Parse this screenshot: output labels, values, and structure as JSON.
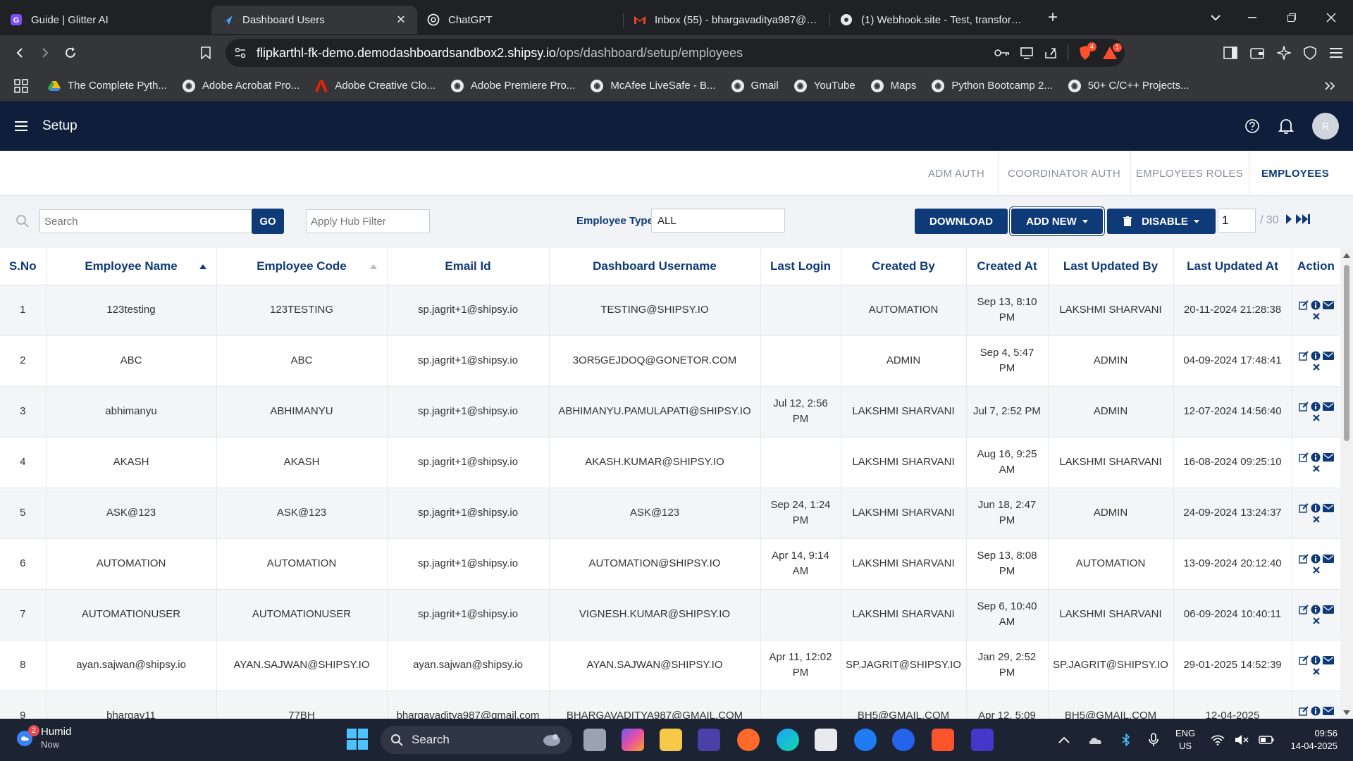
{
  "browser": {
    "tabs": [
      {
        "title": "Guide | Glitter AI",
        "active": false
      },
      {
        "title": "Dashboard Users",
        "active": true
      },
      {
        "title": "ChatGPT",
        "active": false
      },
      {
        "title": "Inbox (55) - bhargavaditya987@gm",
        "active": false
      },
      {
        "title": "(1) Webhook.site - Test, transform a",
        "active": false
      }
    ],
    "url_host": "flipkarthl-fk-demo.demodashboardsandbox2.shipsy.io",
    "url_path": "/ops/dashboard/setup/employees",
    "extension_badges": [
      "4",
      "1"
    ],
    "bookmarks": [
      "The Complete Pyth...",
      "Adobe Acrobat Pro...",
      "Adobe Creative Clo...",
      "Adobe Premiere Pro...",
      "McAfee LiveSafe - B...",
      "Gmail",
      "YouTube",
      "Maps",
      "Python Bootcamp 2...",
      "50+ C/C++ Projects..."
    ]
  },
  "app": {
    "title": "Setup",
    "avatar_initial": "R",
    "sub_tabs": [
      "ADM AUTH",
      "COORDINATOR AUTH",
      "EMPLOYEES ROLES",
      "EMPLOYEES"
    ],
    "active_sub_tab": "EMPLOYEES",
    "colors": {
      "header_bg": "#0e1e3b",
      "primary": "#0e3a78"
    }
  },
  "toolbar": {
    "search_placeholder": "Search",
    "go_label": "GO",
    "hub_filter_placeholder": "Apply Hub Filter",
    "employee_type_label": "Employee Type",
    "employee_type_value": "ALL",
    "download_label": "DOWNLOAD",
    "add_new_label": "ADD NEW",
    "disable_label": "DISABLE",
    "page_value": "1",
    "page_total": "/ 30"
  },
  "table": {
    "columns": [
      "S.No",
      "Employee Name",
      "Employee Code",
      "Email Id",
      "Dashboard Username",
      "Last Login",
      "Created By",
      "Created At",
      "Last Updated By",
      "Last Updated At",
      "Action"
    ],
    "rows": [
      {
        "sno": "1",
        "name": "123testing",
        "code": "123TESTING",
        "email": "sp.jagrit+1@shipsy.io",
        "username": "TESTING@SHIPSY.IO",
        "last_login": "",
        "created_by": "AUTOMATION",
        "created_at": "Sep 13, 8:10 PM",
        "updated_by": "LAKSHMI SHARVANI",
        "updated_at": "20-11-2024 21:28:38"
      },
      {
        "sno": "2",
        "name": "ABC",
        "code": "ABC",
        "email": "sp.jagrit+1@shipsy.io",
        "username": "3OR5GEJDOQ@GONETOR.COM",
        "last_login": "",
        "created_by": "ADMIN",
        "created_at": "Sep 4, 5:47 PM",
        "updated_by": "ADMIN",
        "updated_at": "04-09-2024 17:48:41"
      },
      {
        "sno": "3",
        "name": "abhimanyu",
        "code": "ABHIMANYU",
        "email": "sp.jagrit+1@shipsy.io",
        "username": "ABHIMANYU.PAMULAPATI@SHIPSY.IO",
        "last_login": "Jul 12, 2:56 PM",
        "created_by": "LAKSHMI SHARVANI",
        "created_at": "Jul 7, 2:52 PM",
        "updated_by": "ADMIN",
        "updated_at": "12-07-2024 14:56:40"
      },
      {
        "sno": "4",
        "name": "AKASH",
        "code": "AKASH",
        "email": "sp.jagrit+1@shipsy.io",
        "username": "AKASH.KUMAR@SHIPSY.IO",
        "last_login": "",
        "created_by": "LAKSHMI SHARVANI",
        "created_at": "Aug 16, 9:25 AM",
        "updated_by": "LAKSHMI SHARVANI",
        "updated_at": "16-08-2024 09:25:10"
      },
      {
        "sno": "5",
        "name": "ASK@123",
        "code": "ASK@123",
        "email": "sp.jagrit+1@shipsy.io",
        "username": "ASK@123",
        "last_login": "Sep 24, 1:24 PM",
        "created_by": "LAKSHMI SHARVANI",
        "created_at": "Jun 18, 2:47 PM",
        "updated_by": "ADMIN",
        "updated_at": "24-09-2024 13:24:37"
      },
      {
        "sno": "6",
        "name": "AUTOMATION",
        "code": "AUTOMATION",
        "email": "sp.jagrit+1@shipsy.io",
        "username": "AUTOMATION@SHIPSY.IO",
        "last_login": "Apr 14, 9:14 AM",
        "created_by": "LAKSHMI SHARVANI",
        "created_at": "Sep 13, 8:08 PM",
        "updated_by": "AUTOMATION",
        "updated_at": "13-09-2024 20:12:40"
      },
      {
        "sno": "7",
        "name": "AUTOMATIONUSER",
        "code": "AUTOMATIONUSER",
        "email": "sp.jagrit+1@shipsy.io",
        "username": "VIGNESH.KUMAR@SHIPSY.IO",
        "last_login": "",
        "created_by": "LAKSHMI SHARVANI",
        "created_at": "Sep 6, 10:40 AM",
        "updated_by": "LAKSHMI SHARVANI",
        "updated_at": "06-09-2024 10:40:11"
      },
      {
        "sno": "8",
        "name": "ayan.sajwan@shipsy.io",
        "code": "AYAN.SAJWAN@SHIPSY.IO",
        "email": "ayan.sajwan@shipsy.io",
        "username": "AYAN.SAJWAN@SHIPSY.IO",
        "last_login": "Apr 11, 12:02 PM",
        "created_by": "SP.JAGRIT@SHIPSY.IO",
        "created_at": "Jan 29, 2:52 PM",
        "updated_by": "SP.JAGRIT@SHIPSY.IO",
        "updated_at": "29-01-2025 14:52:39"
      },
      {
        "sno": "9",
        "name": "bhargav11",
        "code": "77BH",
        "email": "bhargavaditya987@gmail.com",
        "username": "BHARGAVADITYA987@GMAIL.COM",
        "last_login": "",
        "created_by": "BH5@GMAIL.COM",
        "created_at": "Apr 12, 5:09",
        "updated_by": "BH5@GMAIL.COM",
        "updated_at": "12-04-2025"
      }
    ]
  },
  "taskbar": {
    "weather_label": "Humid",
    "weather_sub": "Now",
    "weather_badge": "2",
    "search_label": "Search",
    "lang1": "ENG",
    "lang2": "US",
    "time": "09:56",
    "date": "14-04-2025"
  }
}
